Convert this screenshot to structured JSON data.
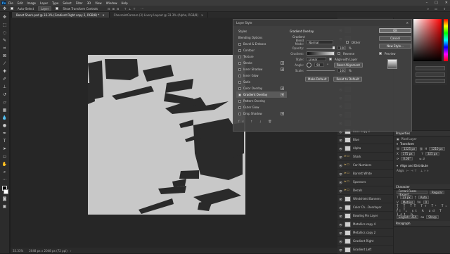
{
  "menubar": {
    "logo": "Ps",
    "items": [
      "File",
      "Edit",
      "Image",
      "Layer",
      "Type",
      "Select",
      "Filter",
      "3D",
      "View",
      "Window",
      "Help"
    ]
  },
  "options": {
    "auto_select": "Auto-Select",
    "target": "Layer",
    "show_transform": "Show Transform Controls"
  },
  "tabs": [
    {
      "label": "Boost Shark.psd @ 33.3% (Gradient Right copy 2, RGB/8) *",
      "active": true
    },
    {
      "label": "ChevroletCamaro (3) Livery Layout @ 33.3% (Alpha, RGB/8)",
      "active": false
    }
  ],
  "status": {
    "zoom": "33.33%",
    "doc": "2048 px x 2048 px (72 ppi)"
  },
  "layer_style": {
    "title": "Layer Style",
    "styles_header": "Styles",
    "items": [
      {
        "label": "Blending Options",
        "checkbox": false,
        "plus": false,
        "highlight": false
      },
      {
        "label": "Bevel & Emboss",
        "checkbox": true,
        "plus": false,
        "highlight": false
      },
      {
        "label": "Contour",
        "checkbox": true,
        "plus": false,
        "highlight": false
      },
      {
        "label": "Texture",
        "checkbox": true,
        "plus": false,
        "highlight": false
      },
      {
        "label": "Stroke",
        "checkbox": true,
        "plus": true,
        "highlight": false
      },
      {
        "label": "Inner Shadow",
        "checkbox": true,
        "plus": true,
        "highlight": false
      },
      {
        "label": "Inner Glow",
        "checkbox": true,
        "plus": false,
        "highlight": false
      },
      {
        "label": "Satin",
        "checkbox": true,
        "plus": false,
        "highlight": false
      },
      {
        "label": "Color Overlay",
        "checkbox": true,
        "plus": true,
        "highlight": false
      },
      {
        "label": "Gradient Overlay",
        "checkbox": true,
        "plus": true,
        "highlight": true
      },
      {
        "label": "Pattern Overlay",
        "checkbox": true,
        "plus": false,
        "highlight": false
      },
      {
        "label": "Outer Glow",
        "checkbox": true,
        "plus": false,
        "highlight": false
      },
      {
        "label": "Drop Shadow",
        "checkbox": true,
        "plus": true,
        "highlight": false
      }
    ],
    "section": "Gradient Overlay",
    "subsection": "Gradient",
    "blend_mode_label": "Blend Mode:",
    "blend_mode": "Normal",
    "dither": "Dither",
    "opacity_label": "Opacity:",
    "opacity": "100",
    "gradient_label": "Gradient:",
    "reverse": "Reverse",
    "style_label": "Style:",
    "style": "Linear",
    "align_layer": "Align with Layer",
    "angle_label": "Angle:",
    "angle": "90",
    "reset_alignment": "Reset Alignment",
    "scale_label": "Scale:",
    "scale": "100",
    "make_default": "Make Default",
    "reset_default": "Reset to Default",
    "ok": "OK",
    "cancel": "Cancel",
    "new_style": "New Style...",
    "preview": "Preview"
  },
  "layers": [
    {
      "name": "",
      "type": "dark",
      "eye": true
    },
    {
      "name": "",
      "type": "dark",
      "eye": true
    },
    {
      "name": "",
      "type": "dark",
      "eye": true
    },
    {
      "name": "",
      "type": "dark",
      "eye": true
    },
    {
      "name": "",
      "type": "dark",
      "eye": true
    },
    {
      "name": "",
      "type": "dark",
      "eye": true
    },
    {
      "name": "",
      "type": "dark",
      "eye": true
    },
    {
      "name": "",
      "type": "dark",
      "eye": true
    },
    {
      "name": "",
      "type": "dark",
      "eye": true
    },
    {
      "name": "",
      "type": "dark",
      "eye": true
    },
    {
      "name": "",
      "type": "dark",
      "eye": true
    },
    {
      "name": "",
      "type": "dark",
      "eye": true
    },
    {
      "name": "",
      "type": "dark",
      "eye": true
    },
    {
      "name": "Base copy 2",
      "type": "light",
      "eye": true
    },
    {
      "name": "Blue",
      "type": "light",
      "eye": true
    },
    {
      "name": "Alpha",
      "type": "light",
      "eye": true
    },
    {
      "name": "Shark",
      "type": "folder",
      "eye": true
    },
    {
      "name": "Car Numbers",
      "type": "folder",
      "eye": true
    },
    {
      "name": "Barrett White",
      "type": "folder",
      "eye": true
    },
    {
      "name": "Sponsors",
      "type": "folder",
      "eye": true
    },
    {
      "name": "Decals",
      "type": "folder",
      "eye": true
    },
    {
      "name": "Windshield Banners",
      "type": "light",
      "eye": true
    },
    {
      "name": "Color Ch...Overlayer",
      "type": "light",
      "eye": true
    },
    {
      "name": "Bowling Pin Layer",
      "type": "light",
      "eye": true
    },
    {
      "name": "Metallics copy 4",
      "type": "light",
      "eye": true
    },
    {
      "name": "Metallics copy 2",
      "type": "light",
      "eye": true
    },
    {
      "name": "Gradient Right",
      "type": "light",
      "eye": true
    },
    {
      "name": "Gradient Left",
      "type": "light",
      "eye": true
    }
  ],
  "properties": {
    "title": "Properties",
    "pixel_layer": "Pixel Layer",
    "transform": "Transform",
    "w": "W",
    "w_val": "1225 px",
    "h": "H",
    "h_val": "1210 px",
    "x": "X",
    "x_val": "175 px",
    "y": "Y",
    "y_val": "325 px",
    "rot": "0.00°",
    "align": "Align and Distribute",
    "align_label": "Align:",
    "character": "Character",
    "font": "Ferrari Faces (Expert...",
    "font_style": "Regular",
    "size": "23 px",
    "leading": "Auto",
    "metrics": "Metrics",
    "tracking": "0",
    "lang": "English: USA",
    "sharp": "Sharp",
    "paragraph": "Paragraph"
  },
  "accent": "#31a8ff"
}
